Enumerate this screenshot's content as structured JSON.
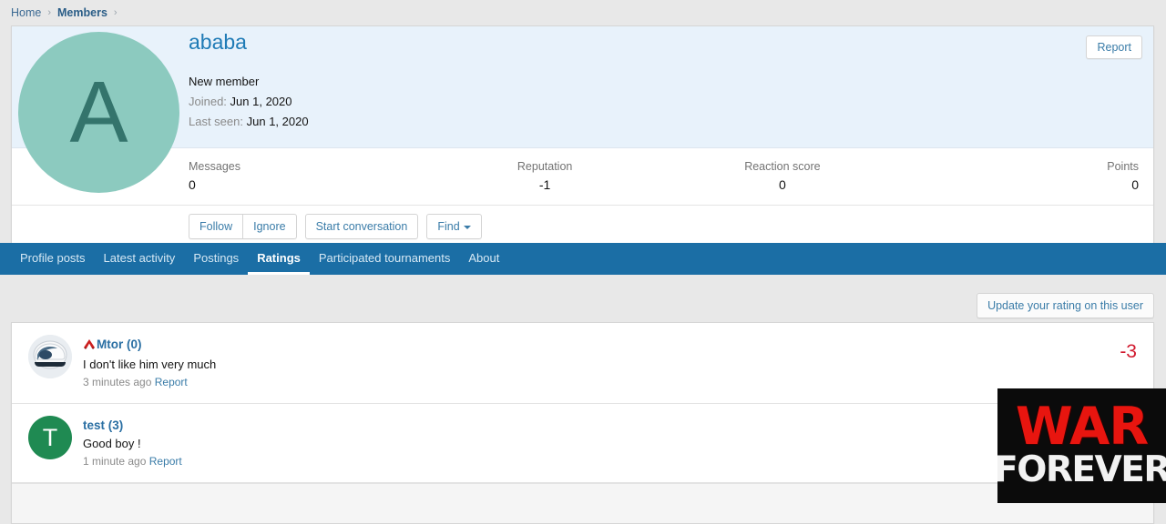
{
  "breadcrumb": {
    "home": "Home",
    "members": "Members",
    "separator": "›"
  },
  "profile": {
    "username": "ababa",
    "avatar_letter": "A",
    "avatar_color": "#8ccabf",
    "user_title": "New member",
    "joined_label": "Joined:",
    "joined_value": "Jun 1, 2020",
    "last_seen_label": "Last seen:",
    "last_seen_value": "Jun 1, 2020",
    "report_label": "Report"
  },
  "stats": [
    {
      "label": "Messages",
      "value": "0"
    },
    {
      "label": "Reputation",
      "value": "-1"
    },
    {
      "label": "Reaction score",
      "value": "0"
    },
    {
      "label": "Points",
      "value": "0"
    }
  ],
  "actions": {
    "follow": "Follow",
    "ignore": "Ignore",
    "start_conversation": "Start conversation",
    "find": "Find"
  },
  "tabs": [
    {
      "label": "Profile posts",
      "active": false
    },
    {
      "label": "Latest activity",
      "active": false
    },
    {
      "label": "Postings",
      "active": false
    },
    {
      "label": "Ratings",
      "active": true
    },
    {
      "label": "Participated tournaments",
      "active": false
    },
    {
      "label": "About",
      "active": false
    }
  ],
  "ratings": {
    "update_button": "Update your rating on this user",
    "items": [
      {
        "rater": "Mtor (0)",
        "avatar_type": "helmet-avatar",
        "rank_icon": "red-a-badge-icon",
        "text": "I don't like him very much",
        "time": "3 minutes ago",
        "report": "Report",
        "score": "-3",
        "score_color": "#d1192e"
      },
      {
        "rater": "test (3)",
        "avatar_type": "letter-avatar",
        "avatar_letter": "T",
        "avatar_color": "#1f8a52",
        "text": "Good boy !",
        "time": "1 minute ago",
        "report": "Report",
        "score": "",
        "score_color": "#d1192e"
      }
    ]
  },
  "ad": {
    "line1": "WAR",
    "line2": "FOREVER"
  }
}
